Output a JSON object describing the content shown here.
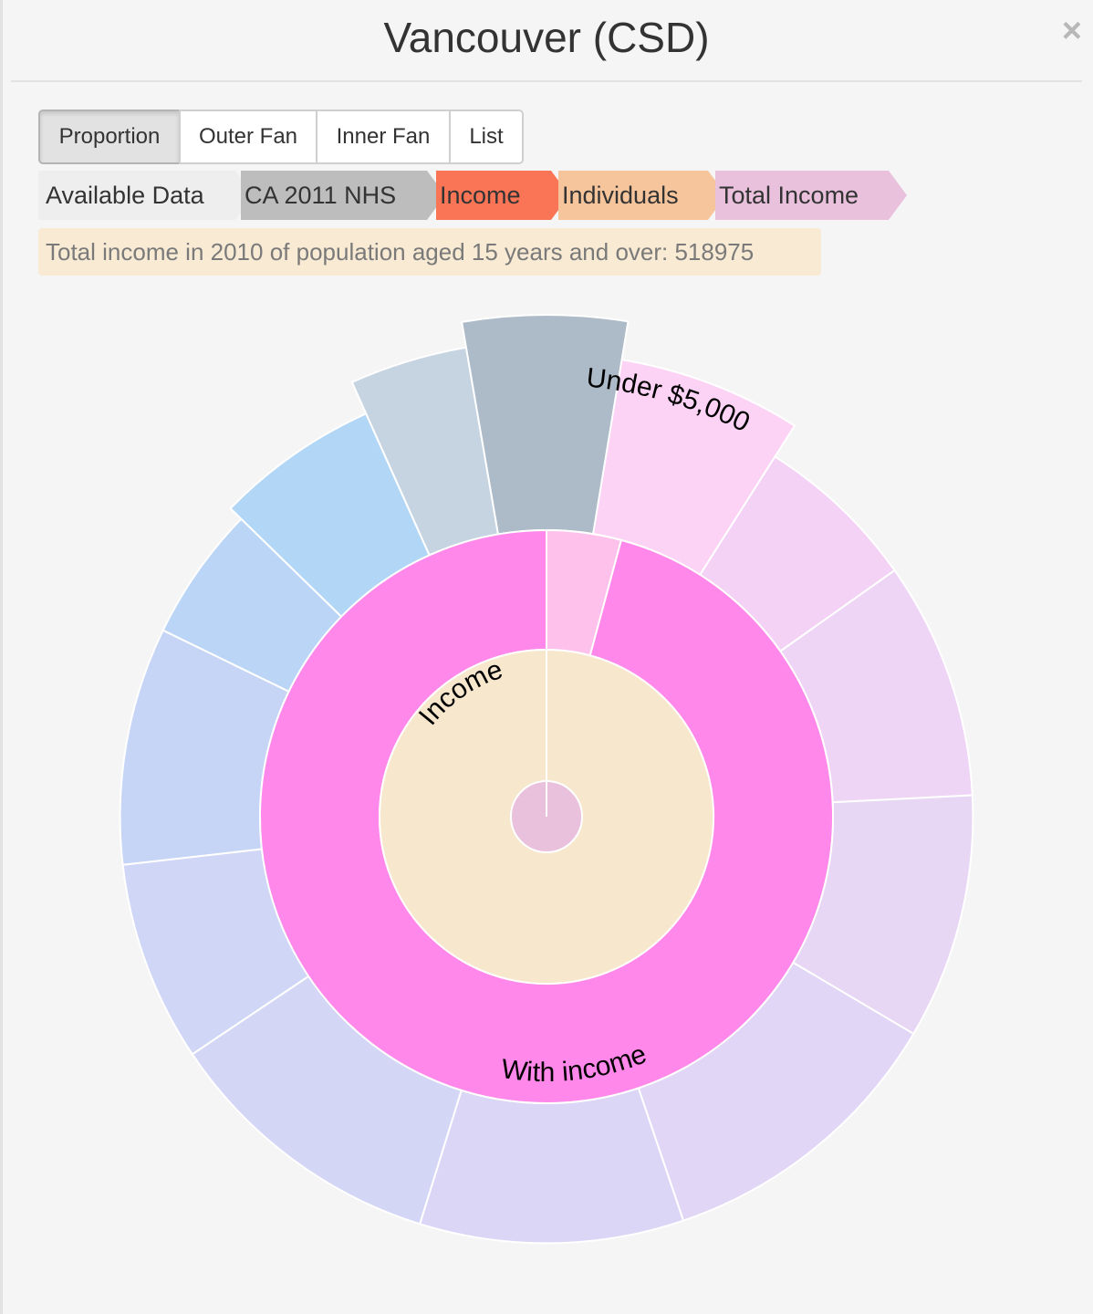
{
  "modal": {
    "title": "Vancouver (CSD)",
    "close_icon": "×"
  },
  "view_buttons": [
    {
      "label": "Proportion",
      "active": true
    },
    {
      "label": "Outer Fan",
      "active": false
    },
    {
      "label": "Inner Fan",
      "active": false
    },
    {
      "label": "List",
      "active": false
    }
  ],
  "breadcrumbs": [
    {
      "label": "Available Data",
      "color": "#eeeeee"
    },
    {
      "label": "CA 2011 NHS",
      "color": "#bdbdbd"
    },
    {
      "label": "Income",
      "color": "#f97556"
    },
    {
      "label": "Individuals",
      "color": "#f6c59c"
    },
    {
      "label": "Total Income",
      "color": "#e9c1dc"
    }
  ],
  "info": {
    "text": "Total income in 2010 of population aged 15 years and over: 518975"
  },
  "chart_data": {
    "type": "sunburst",
    "root": {
      "color": "#e9c1dc"
    },
    "rings": [
      {
        "level": 1,
        "segments": [
          {
            "label": "Income",
            "share": 1.0,
            "color": "#f7e7cc"
          }
        ]
      },
      {
        "level": 2,
        "segments": [
          {
            "label": "",
            "share": 0.042,
            "color": "#fdc1ec"
          },
          {
            "label": "With income",
            "share": 0.958,
            "color": "#ff88ea"
          }
        ]
      },
      {
        "level": 3,
        "segments": [
          {
            "label": "Under $5,000",
            "share": 0.09,
            "value": 0.82,
            "color": "#fcd2f5"
          },
          {
            "label": "",
            "share": 0.062,
            "value": 0.65,
            "color": "#f4d2f5"
          },
          {
            "label": "",
            "share": 0.09,
            "value": 0.65,
            "color": "#eed4f5"
          },
          {
            "label": "",
            "share": 0.093,
            "value": 0.65,
            "color": "#e8d6f5"
          },
          {
            "label": "",
            "share": 0.113,
            "value": 0.65,
            "color": "#e1d6f6"
          },
          {
            "label": "",
            "share": 0.1,
            "value": 0.65,
            "color": "#dbd5f6"
          },
          {
            "label": "",
            "share": 0.108,
            "value": 0.65,
            "color": "#d4d6f6"
          },
          {
            "label": "",
            "share": 0.076,
            "value": 0.65,
            "color": "#cfd6f6"
          },
          {
            "label": "",
            "share": 0.09,
            "value": 0.65,
            "color": "#c6d5f6"
          },
          {
            "label": "",
            "share": 0.051,
            "value": 0.65,
            "color": "#bbd5f6"
          },
          {
            "label": "",
            "share": 0.06,
            "value": 0.72,
            "color": "#b2d6f6"
          },
          {
            "label": "",
            "share": 0.04,
            "value": 0.88,
            "color": "#c6d4e2"
          },
          {
            "label": "",
            "share": 0.053,
            "value": 1.0,
            "color": "#adbbc9"
          }
        ]
      }
    ]
  }
}
